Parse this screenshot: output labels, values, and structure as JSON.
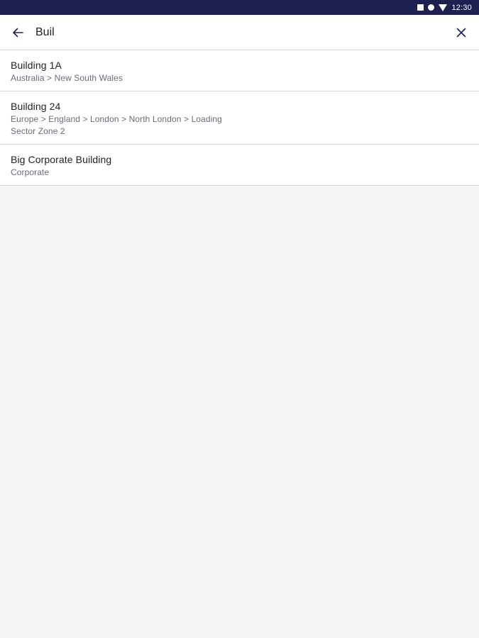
{
  "status_bar": {
    "time": "12:30",
    "icons": [
      "square-icon",
      "circle-icon",
      "wifi-icon"
    ],
    "background": "#1e2050"
  },
  "search": {
    "query": "Buil",
    "back_icon": "arrow-left-icon",
    "clear_icon": "close-icon"
  },
  "results": [
    {
      "title": "Building 1A",
      "lines": [
        "Australia > New South Wales"
      ]
    },
    {
      "title": "Building 24",
      "lines": [
        "Europe > England > London > North London > Loading",
        "Sector Zone 2"
      ]
    },
    {
      "title": "Big Corporate Building",
      "lines": [
        "Corporate"
      ]
    }
  ]
}
